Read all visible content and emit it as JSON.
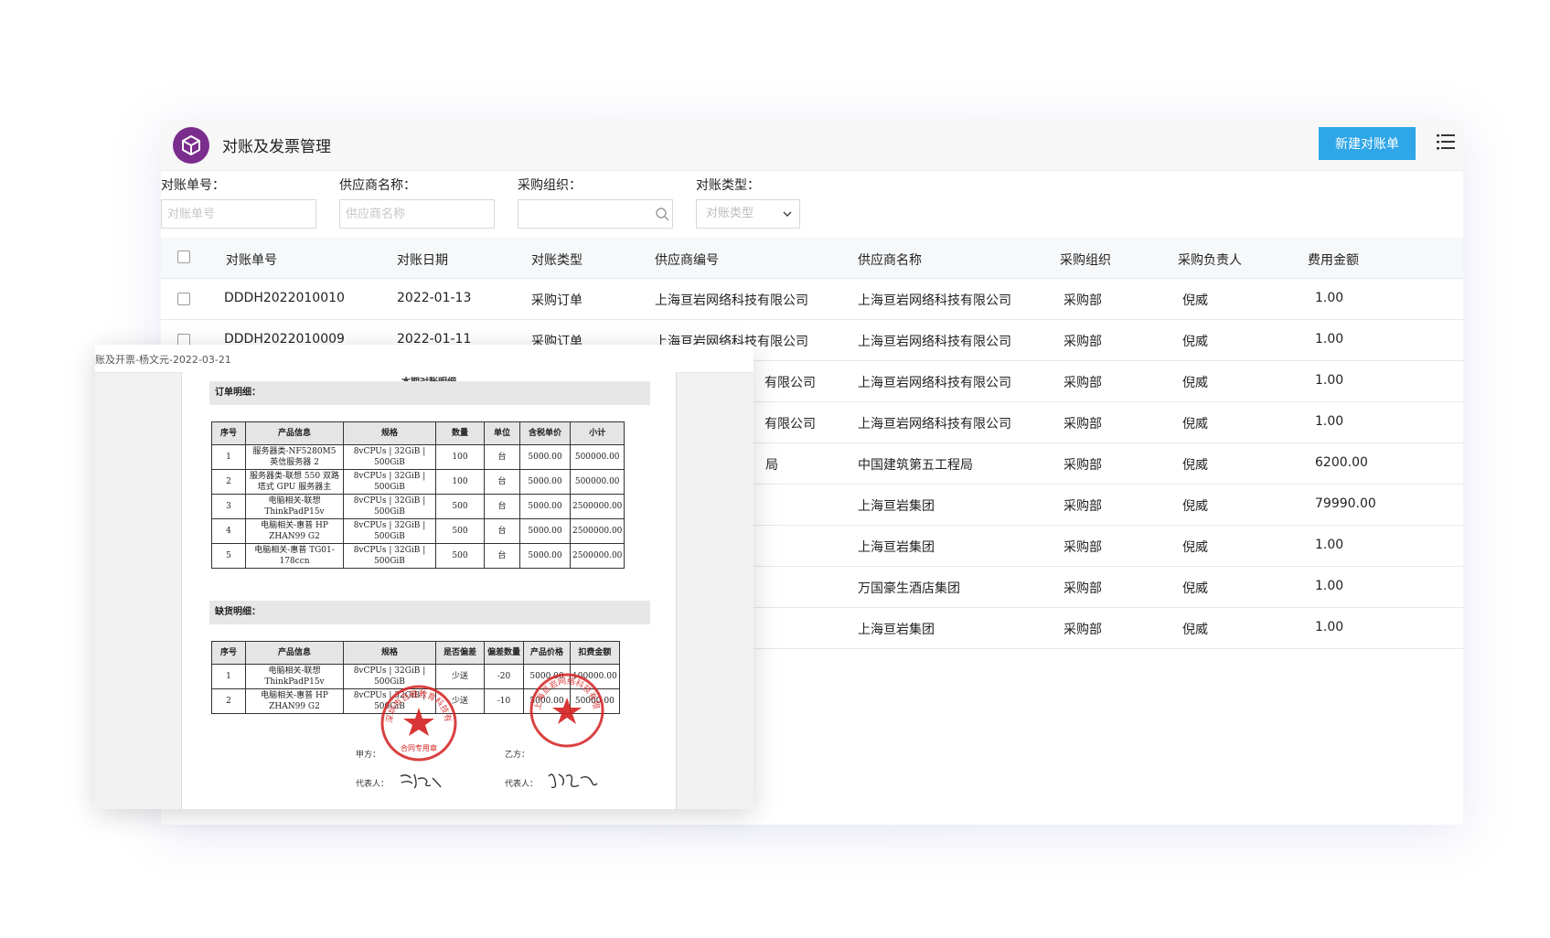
{
  "app": {
    "title": "对账及发票管理",
    "new_button": "新建对账单",
    "accent_color": "#2ea6e8",
    "logo_color": "#7b2d8e",
    "logo_icon": "cube-icon",
    "menu_icon": "list-icon"
  },
  "filters": {
    "number": {
      "label": "对账单号：",
      "placeholder": "对账单号"
    },
    "supplier": {
      "label": "供应商名称：",
      "placeholder": "供应商名称"
    },
    "org": {
      "label": "采购组织：",
      "placeholder": ""
    },
    "type": {
      "label": "对账类型：",
      "placeholder": "对账类型"
    }
  },
  "table": {
    "columns": [
      "对账单号",
      "对账日期",
      "对账类型",
      "供应商编号",
      "供应商名称",
      "采购组织",
      "采购负责人",
      "费用金额"
    ],
    "rows": [
      [
        "DDDH2022010010",
        "2022-01-13",
        "采购订单",
        "上海亘岩网络科技有限公司",
        "上海亘岩网络科技有限公司",
        "采购部",
        "倪威",
        "1.00"
      ],
      [
        "DDDH2022010009",
        "2022-01-11",
        "采购订单",
        "上海亘岩网络科技有限公司",
        "上海亘岩网络科技有限公司",
        "采购部",
        "倪威",
        "1.00"
      ],
      [
        "",
        "",
        "",
        "有限公司",
        "上海亘岩网络科技有限公司",
        "采购部",
        "倪威",
        "1.00"
      ],
      [
        "",
        "",
        "",
        "有限公司",
        "上海亘岩网络科技有限公司",
        "采购部",
        "倪威",
        "1.00"
      ],
      [
        "",
        "",
        "",
        "局",
        "中国建筑第五工程局",
        "采购部",
        "倪威",
        "6200.00"
      ],
      [
        "",
        "",
        "",
        "",
        "上海亘岩集团",
        "采购部",
        "倪威",
        "79990.00"
      ],
      [
        "",
        "",
        "",
        "",
        "上海亘岩集团",
        "采购部",
        "倪威",
        "1.00"
      ],
      [
        "",
        "",
        "",
        "",
        "万国豪生酒店集团",
        "采购部",
        "倪威",
        "1.00"
      ],
      [
        "",
        "",
        "",
        "",
        "上海亘岩集团",
        "采购部",
        "倪威",
        "1.00"
      ]
    ]
  },
  "document": {
    "title": "账及开票-杨文元-2022-03-21",
    "heading": "本期对账明细",
    "orders": {
      "section": "订单明细：",
      "columns": [
        "序号",
        "产品信息",
        "规格",
        "数量",
        "单位",
        "含税单价",
        "小计"
      ],
      "rows": [
        [
          "1",
          "服务器类-NF5280M5 英信服务器 2",
          "8vCPUs | 32GiB | 500GiB",
          "100",
          "台",
          "5000.00",
          "500000.00"
        ],
        [
          "2",
          "服务器类-联想 550 双路塔式 GPU 服务器主",
          "8vCPUs | 32GiB | 500GiB",
          "100",
          "台",
          "5000.00",
          "500000.00"
        ],
        [
          "3",
          "电脑相关-联想 ThinkPadP15v",
          "8vCPUs | 32GiB | 500GiB",
          "500",
          "台",
          "5000.00",
          "2500000.00"
        ],
        [
          "4",
          "电脑相关-惠普 HP ZHAN99 G2",
          "8vCPUs | 32GiB | 500GiB",
          "500",
          "台",
          "5000.00",
          "2500000.00"
        ],
        [
          "5",
          "电脑相关-惠普 TG01-178ccn",
          "8vCPUs | 32GiB | 500GiB",
          "500",
          "台",
          "5000.00",
          "2500000.00"
        ]
      ]
    },
    "shortage": {
      "section": "缺货明细：",
      "columns": [
        "序号",
        "产品信息",
        "规格",
        "是否偏差",
        "偏差数量",
        "产品价格",
        "扣费金额"
      ],
      "rows": [
        [
          "1",
          "电脑相关-联想 ThinkPadP15v",
          "8vCPUs | 32GiB | 500GiB",
          "少送",
          "-20",
          "5000.00",
          "100000.00"
        ],
        [
          "2",
          "电脑相关-惠普 HP ZHAN99 G2",
          "8vCPUs | 32GiB | 500GiB",
          "少送",
          "-10",
          "5000.00",
          "50000.00"
        ]
      ]
    },
    "party_a_label": "甲方：",
    "party_b_label": "乙方：",
    "rep_a_label": "代表人：",
    "rep_b_label": "代表人：",
    "stamp_a_text": "深圳市百稳教育科技有限公司",
    "stamp_a_sub": "合同专用章",
    "stamp_b_text": "上海亘岩网络科技有限公司",
    "stamp_color": "#d42020"
  }
}
